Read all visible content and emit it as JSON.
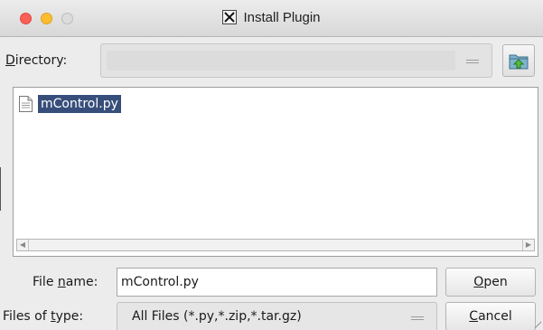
{
  "window": {
    "title": "Install Plugin",
    "title_icon": "x11-icon",
    "controls": [
      "close",
      "minimize",
      "maximize"
    ]
  },
  "directory": {
    "label_underlined": "D",
    "label_rest": "irectory:",
    "value": "",
    "up_button_icon": "folder-up-icon"
  },
  "file_list": {
    "items": [
      {
        "name": "mControl.py",
        "icon": "file-icon",
        "selected": true
      }
    ]
  },
  "file_name": {
    "label_pre": "File ",
    "label_underlined": "n",
    "label_post": "ame:",
    "value": "mControl.py"
  },
  "file_type": {
    "label_pre": "Files of ",
    "label_underlined": "t",
    "label_post": "ype:",
    "selected": "All Files (*.py,*.zip,*.tar.gz)"
  },
  "buttons": {
    "open_underlined": "O",
    "open_rest": "pen",
    "cancel_underlined": "C",
    "cancel_rest": "ancel"
  },
  "colors": {
    "selection": "#374e7b",
    "close": "#fc5f56",
    "minimize": "#fdbc2e",
    "maximize": "#dcdcdc"
  }
}
